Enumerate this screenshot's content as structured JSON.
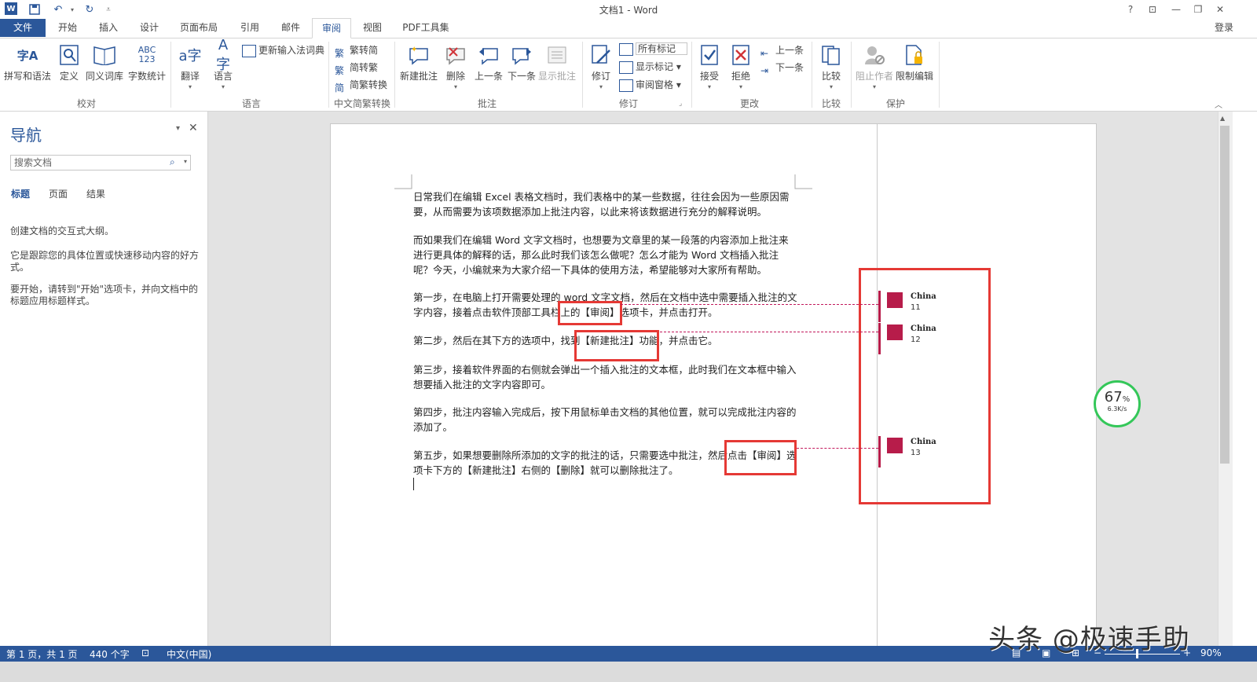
{
  "window": {
    "title": "文档1 - Word",
    "help": "?",
    "signin": "登录"
  },
  "tabs": [
    "文件",
    "开始",
    "插入",
    "设计",
    "页面布局",
    "引用",
    "邮件",
    "审阅",
    "视图",
    "PDF工具集"
  ],
  "ribbon": {
    "proofing": {
      "spelling": "拼写和语法",
      "define": "定义",
      "thesaurus": "同义词库",
      "wordcount": "字数统计",
      "label": "校对"
    },
    "language": {
      "translate": "翻译",
      "language": "语言",
      "update_ime": "更新输入法词典",
      "label": "语言"
    },
    "chinese": {
      "t2s": "繁转简",
      "s2t": "简转繁",
      "convert": "简繁转换",
      "label": "中文简繁转换"
    },
    "comments": {
      "new": "新建批注",
      "delete": "删除",
      "prev": "上一条",
      "next": "下一条",
      "show": "显示批注",
      "label": "批注"
    },
    "tracking": {
      "track": "修订",
      "markup": "所有标记",
      "show_markup": "显示标记",
      "pane": "审阅窗格",
      "label": "修订"
    },
    "changes": {
      "accept": "接受",
      "reject": "拒绝",
      "prev": "上一条",
      "next": "下一条",
      "label": "更改"
    },
    "compare": {
      "compare": "比较",
      "label": "比较"
    },
    "protect": {
      "block": "阻止作者",
      "restrict": "限制编辑",
      "label": "保护"
    }
  },
  "nav": {
    "title": "导航",
    "search_placeholder": "搜索文档",
    "tabs": [
      "标题",
      "页面",
      "结果"
    ],
    "help1": "创建文档的交互式大纲。",
    "help2": "它是跟踪您的具体位置或快速移动内容的好方式。",
    "help3": "要开始，请转到\"开始\"选项卡，并向文档中的标题应用标题样式。"
  },
  "document": {
    "p1": "日常我们在编辑 Excel 表格文档时，我们表格中的某一些数据，往往会因为一些原因需要，从而需要为该项数据添加上批注内容，以此来将该数据进行充分的解释说明。",
    "p2": "而如果我们在编辑 Word 文字文档时，也想要为文章里的某一段落的内容添加上批注来进行更具体的解释的话，那么此时我们该怎么做呢？怎么才能为 Word 文档插入批注呢？今天，小编就来为大家介绍一下具体的使用方法，希望能够对大家所有帮助。",
    "p3": "第一步，在电脑上打开需要处理的 word 文字文档，然后在文档中选中需要插入批注的文字内容，接着点击软件顶部工具栏上的【审阅】选项卡，并点击打开。",
    "p4": "第二步，然后在其下方的选项中，找到【新建批注】功能，并点击它。",
    "p5": "第三步，接着软件界面的右侧就会弹出一个插入批注的文本框，此时我们在文本框中输入想要插入批注的文字内容即可。",
    "p6": "第四步，批注内容输入完成后，按下用鼠标单击文档的其他位置，就可以完成批注内容的添加了。",
    "p7": "第五步，如果想要删除所添加的文字的批注的话，只需要选中批注，然后点击【审阅】选项卡下方的【新建批注】右侧的【删除】就可以删除批注了。"
  },
  "comments": [
    {
      "author": "China",
      "text": "11"
    },
    {
      "author": "China",
      "text": "12"
    },
    {
      "author": "China",
      "text": "13"
    }
  ],
  "status": {
    "page": "第 1 页，共 1 页",
    "words": "440 个字",
    "lang": "中文(中国)",
    "zoom": "90%"
  },
  "speed": {
    "percent": "67",
    "unit": "%",
    "rate": "6.3K/s"
  },
  "watermark": "头条 @极速手助"
}
